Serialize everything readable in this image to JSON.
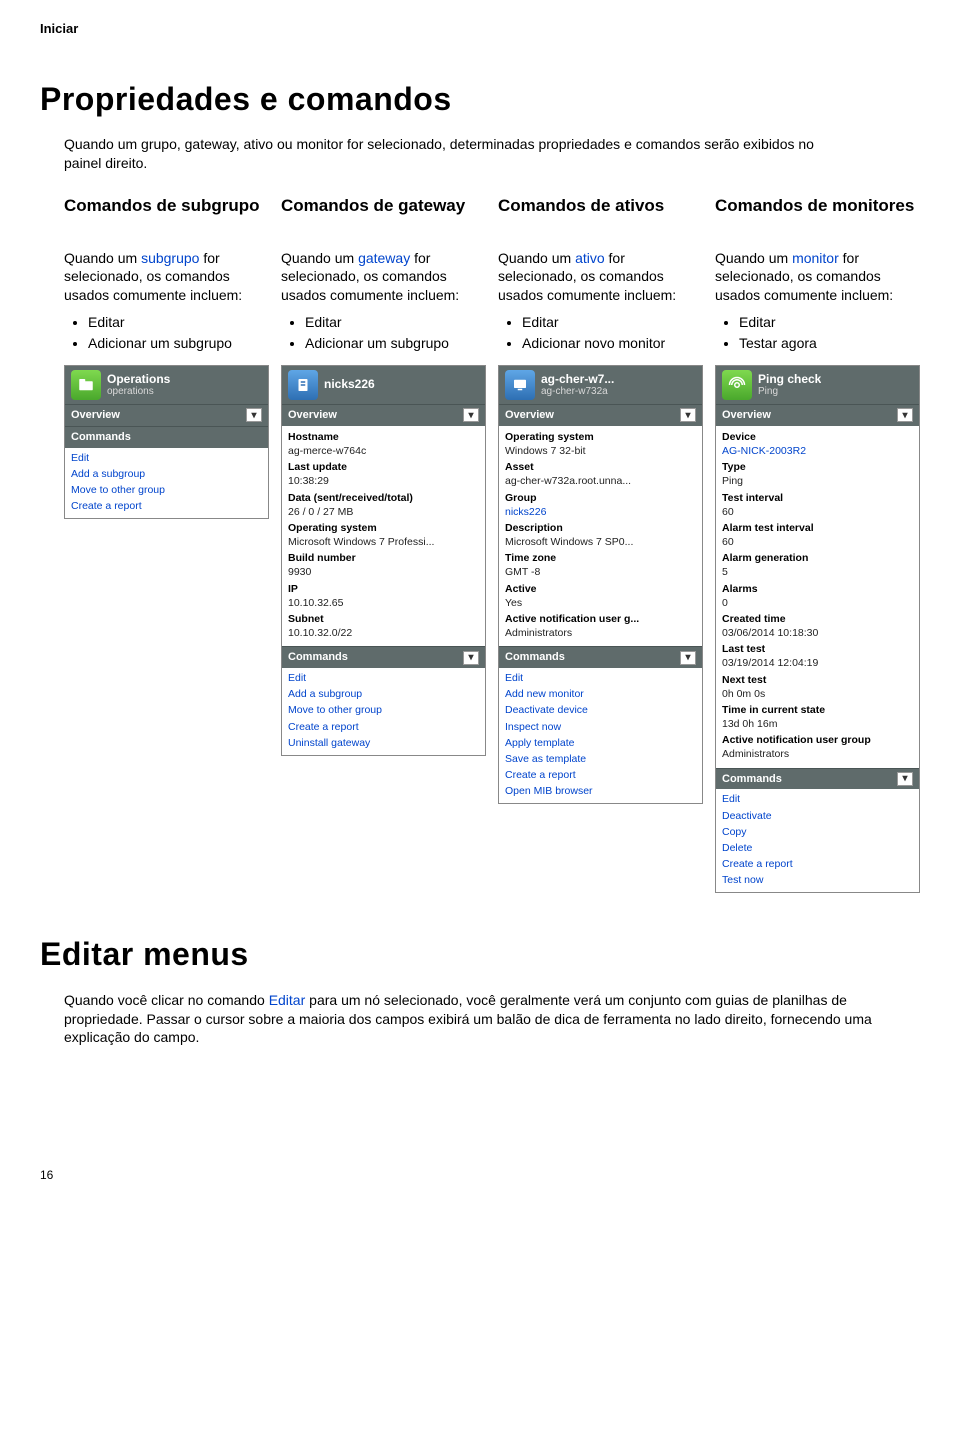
{
  "page": {
    "header_label": "Iniciar",
    "page_number": "16"
  },
  "section1": {
    "title": "Propriedades e comandos",
    "intro": "Quando um grupo, gateway, ativo ou monitor for selecionado, determinadas propriedades e comandos serão exibidos no painel direito."
  },
  "cols": {
    "subgrupo": {
      "heading": "Comandos de subgrupo",
      "desc_pre": "Quando um ",
      "desc_link": "subgrupo",
      "desc_post": " for selecionado, os comandos usados comumente incluem:",
      "b1": "Editar",
      "b2": "Adicionar um subgrupo"
    },
    "gateway": {
      "heading": "Comandos de gateway",
      "desc_pre": "Quando um ",
      "desc_link": "gateway",
      "desc_post": " for selecionado, os comandos usados comumente incluem:",
      "b1": "Editar",
      "b2": "Adicionar um subgrupo"
    },
    "ativos": {
      "heading": "Comandos de ativos",
      "desc_pre": "Quando um ",
      "desc_link": "ativo",
      "desc_post": " for selecionado, os comandos usados comumente incluem:",
      "b1": "Editar",
      "b2": "Adicionar novo monitor"
    },
    "monitores": {
      "heading": "Comandos de monitores",
      "desc_pre": "Quando um ",
      "desc_link": "monitor",
      "desc_post": " for selecionado, os comandos usados comumente incluem:",
      "b1": "Editar",
      "b2": "Testar agora"
    }
  },
  "panel_subgrupo": {
    "title": "Operations",
    "subtitle": "operations",
    "overview_label": "Overview",
    "commands_label": "Commands",
    "cmds": {
      "c0": "Edit",
      "c1": "Add a subgroup",
      "c2": "Move to other group",
      "c3": "Create a report"
    }
  },
  "panel_gateway": {
    "title": "nicks226",
    "overview_label": "Overview",
    "kv": {
      "k0": "Hostname",
      "v0": "ag-merce-w764c",
      "k1": "Last update",
      "v1": "10:38:29",
      "k2": "Data (sent/received/total)",
      "v2": "26 / 0 / 27 MB",
      "k3": "Operating system",
      "v3": "Microsoft Windows 7 Professi...",
      "k4": "Build number",
      "v4": "9930",
      "k5": "IP",
      "v5": "10.10.32.65",
      "k6": "Subnet",
      "v6": "10.10.32.0/22"
    },
    "commands_label": "Commands",
    "cmds": {
      "c0": "Edit",
      "c1": "Add a subgroup",
      "c2": "Move to other group",
      "c3": "Create a report",
      "c4": "Uninstall gateway"
    }
  },
  "panel_ativo": {
    "title": "ag-cher-w7...",
    "subtitle": "ag-cher-w732a",
    "overview_label": "Overview",
    "kv": {
      "k0": "Operating system",
      "v0": "Windows 7 32-bit",
      "k1": "Asset",
      "v1": "ag-cher-w732a.root.unna...",
      "k2": "Group",
      "v2": "nicks226",
      "k3": "Description",
      "v3": "Microsoft Windows 7 SP0...",
      "k4": "Time zone",
      "v4": "GMT -8",
      "k5": "Active",
      "v5": "Yes",
      "k6": "Active notification user g...",
      "v6": "Administrators"
    },
    "commands_label": "Commands",
    "cmds": {
      "c0": "Edit",
      "c1": "Add new monitor",
      "c2": "Deactivate device",
      "c3": "Inspect now",
      "c4": "Apply template",
      "c5": "Save as template",
      "c6": "Create a report",
      "c7": "Open MIB browser"
    }
  },
  "panel_monitor": {
    "title": "Ping check",
    "subtitle": "Ping",
    "overview_label": "Overview",
    "kv": {
      "k0": "Device",
      "v0": "AG-NICK-2003R2",
      "k1": "Type",
      "v1": "Ping",
      "k2": "Test interval",
      "v2": "60",
      "k3": "Alarm test interval",
      "v3": "60",
      "k4": "Alarm generation",
      "v4": "5",
      "k5": "Alarms",
      "v5": "0",
      "k6": "Created time",
      "v6": "03/06/2014 10:18:30",
      "k7": "Last test",
      "v7": "03/19/2014 12:04:19",
      "k8": "Next test",
      "v8": "0h 0m 0s",
      "k9": "Time in current state",
      "v9": "13d 0h 16m",
      "k10": "Active notification user group",
      "v10": "Administrators"
    },
    "commands_label": "Commands",
    "cmds": {
      "c0": "Edit",
      "c1": "Deactivate",
      "c2": "Copy",
      "c3": "Delete",
      "c4": "Create a report",
      "c5": "Test now"
    }
  },
  "section2": {
    "title": "Editar menus",
    "body_pre": "Quando você clicar no comando ",
    "body_link": "Editar",
    "body_post": " para um nó selecionado, você geralmente verá um conjunto com guias de planilhas de propriedade. Passar o cursor sobre a maioria dos campos exibirá um balão de dica de ferramenta no lado direito, fornecendo uma explicação do campo."
  }
}
